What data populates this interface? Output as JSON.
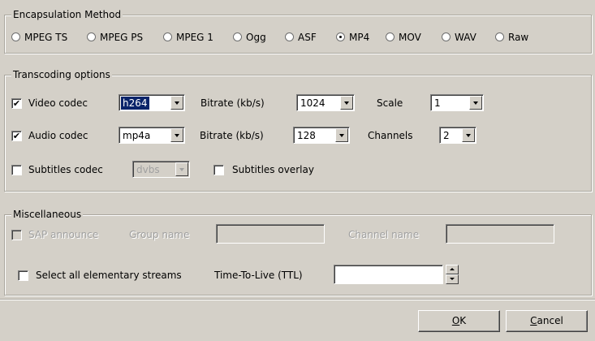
{
  "encapsulation": {
    "legend": "Encapsulation Method",
    "options": [
      {
        "label": "MPEG TS",
        "selected": false
      },
      {
        "label": "MPEG PS",
        "selected": false
      },
      {
        "label": "MPEG 1",
        "selected": false
      },
      {
        "label": "Ogg",
        "selected": false
      },
      {
        "label": "ASF",
        "selected": false
      },
      {
        "label": "MP4",
        "selected": true
      },
      {
        "label": "MOV",
        "selected": false
      },
      {
        "label": "WAV",
        "selected": false
      },
      {
        "label": "Raw",
        "selected": false
      }
    ]
  },
  "transcoding": {
    "legend": "Transcoding options",
    "video": {
      "label": "Video codec",
      "checked": true,
      "codec": "h264",
      "bitrate_label": "Bitrate (kb/s)",
      "bitrate": "1024",
      "scale_label": "Scale",
      "scale": "1"
    },
    "audio": {
      "label": "Audio codec",
      "checked": true,
      "codec": "mp4a",
      "bitrate_label": "Bitrate (kb/s)",
      "bitrate": "128",
      "channels_label": "Channels",
      "channels": "2"
    },
    "subtitles": {
      "label": "Subtitles codec",
      "checked": false,
      "codec": "dvbs",
      "overlay_label": "Subtitles overlay",
      "overlay_checked": false
    }
  },
  "misc": {
    "legend": "Miscellaneous",
    "sap_label": "SAP announce",
    "group_name_label": "Group name",
    "group_name_value": "",
    "channel_name_label": "Channel name",
    "channel_name_value": "",
    "select_all_label": "Select all elementary streams",
    "select_all_checked": false,
    "ttl_label": "Time-To-Live (TTL)",
    "ttl_value": ""
  },
  "buttons": {
    "ok_mnemonic": "O",
    "ok_rest": "K",
    "cancel_mnemonic": "C",
    "cancel_rest": "ancel"
  }
}
